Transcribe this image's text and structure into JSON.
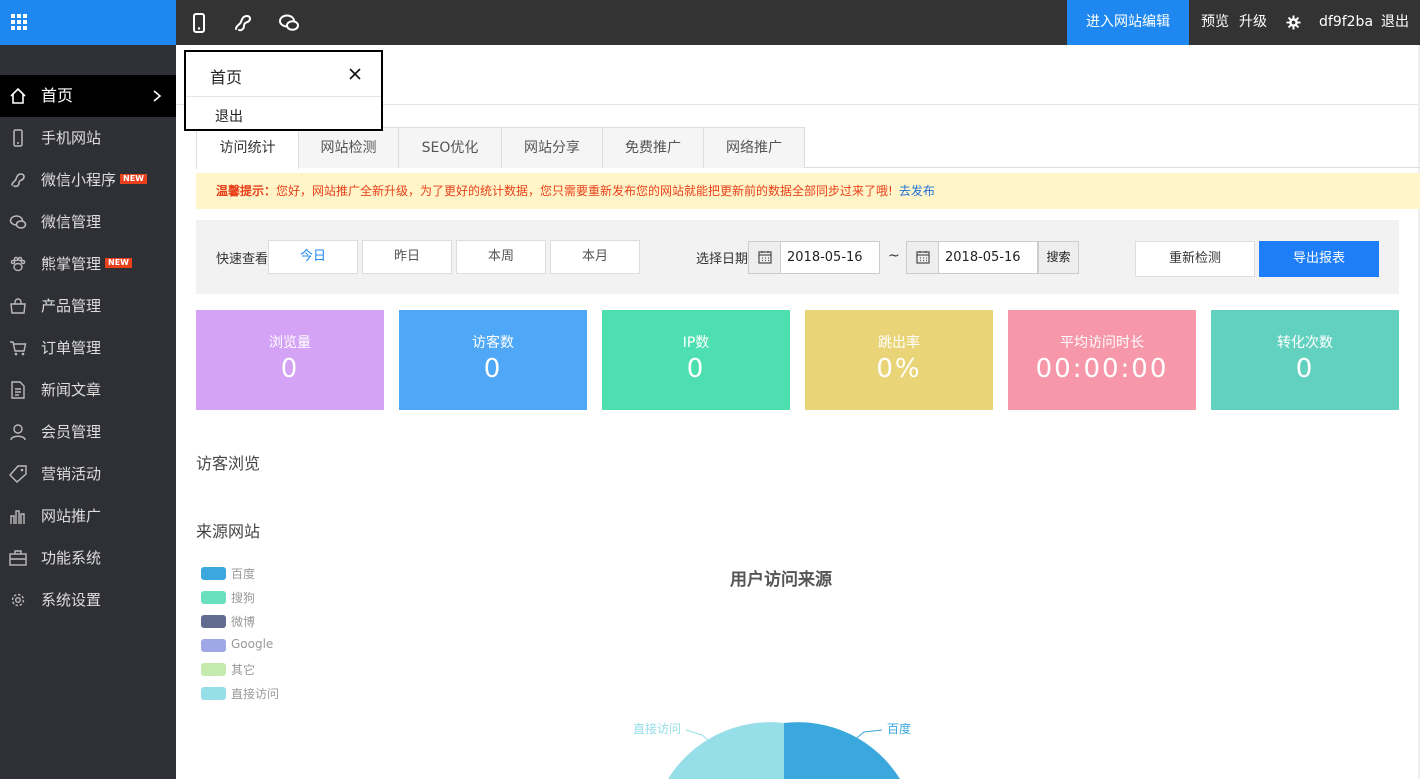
{
  "topbar": {
    "enter_edit": "进入网站编辑",
    "preview": "预览",
    "upgrade": "升级",
    "username": "df9f2ba",
    "logout": "退出"
  },
  "sidebar": {
    "items": [
      {
        "label": "首页",
        "icon": "home-icon"
      },
      {
        "label": "手机网站",
        "icon": "phone-icon"
      },
      {
        "label": "微信小程序",
        "icon": "link-icon",
        "badge": "NEW"
      },
      {
        "label": "微信管理",
        "icon": "chat-icon"
      },
      {
        "label": "熊掌管理",
        "icon": "paw-icon",
        "badge": "NEW"
      },
      {
        "label": "产品管理",
        "icon": "bag-icon"
      },
      {
        "label": "订单管理",
        "icon": "cart-icon"
      },
      {
        "label": "新闻文章",
        "icon": "document-icon"
      },
      {
        "label": "会员管理",
        "icon": "user-icon"
      },
      {
        "label": "营销活动",
        "icon": "tag-icon"
      },
      {
        "label": "网站推广",
        "icon": "bar-chart-icon"
      },
      {
        "label": "功能系统",
        "icon": "briefcase-icon"
      },
      {
        "label": "系统设置",
        "icon": "gear-icon"
      }
    ]
  },
  "popup": {
    "title": "首页",
    "exit": "退出"
  },
  "tabs": [
    "访问统计",
    "网站检测",
    "SEO优化",
    "网站分享",
    "免费推广",
    "网络推广"
  ],
  "notice": {
    "prefix": "温馨提示：",
    "text": "您好，网站推广全新升级，为了更好的统计数据，您只需要重新发布您的网站就能把更新前的数据全部同步过来了哦!",
    "link": "去发布"
  },
  "filter": {
    "quick_label": "快速查看",
    "quick_buttons": [
      "今日",
      "昨日",
      "本周",
      "本月"
    ],
    "date_label": "选择日期",
    "start_date": "2018-05-16",
    "tilde": "~",
    "end_date": "2018-05-16",
    "search": "搜索",
    "recheck": "重新检测",
    "export": "导出报表"
  },
  "stats": [
    {
      "label": "浏览量",
      "value": "0",
      "color": "#d4a3f5"
    },
    {
      "label": "访客数",
      "value": "0",
      "color": "#4ea8f7"
    },
    {
      "label": "IP数",
      "value": "0",
      "color": "#4ddfb0"
    },
    {
      "label": "跳出率",
      "value": "0%",
      "color": "#e9d478"
    },
    {
      "label": "平均访问时长",
      "value": "00:00:00",
      "color": "#f797aa"
    },
    {
      "label": "转化次数",
      "value": "0",
      "color": "#63d1bf"
    }
  ],
  "sections": {
    "visitors": "访客浏览",
    "sources": "来源网站"
  },
  "chart_data": {
    "type": "pie",
    "title": "用户访问来源",
    "legend": [
      {
        "name": "百度",
        "color": "#3aa8dc"
      },
      {
        "name": "搜狗",
        "color": "#69e0bf"
      },
      {
        "name": "微博",
        "color": "#626c91"
      },
      {
        "name": "Google",
        "color": "#a0a7e6"
      },
      {
        "name": "其它",
        "color": "#c4ebad"
      },
      {
        "name": "直接访问",
        "color": "#96dee8"
      }
    ],
    "visible_slice_labels": [
      "直接访问",
      "百度"
    ],
    "legend_position": "left"
  }
}
